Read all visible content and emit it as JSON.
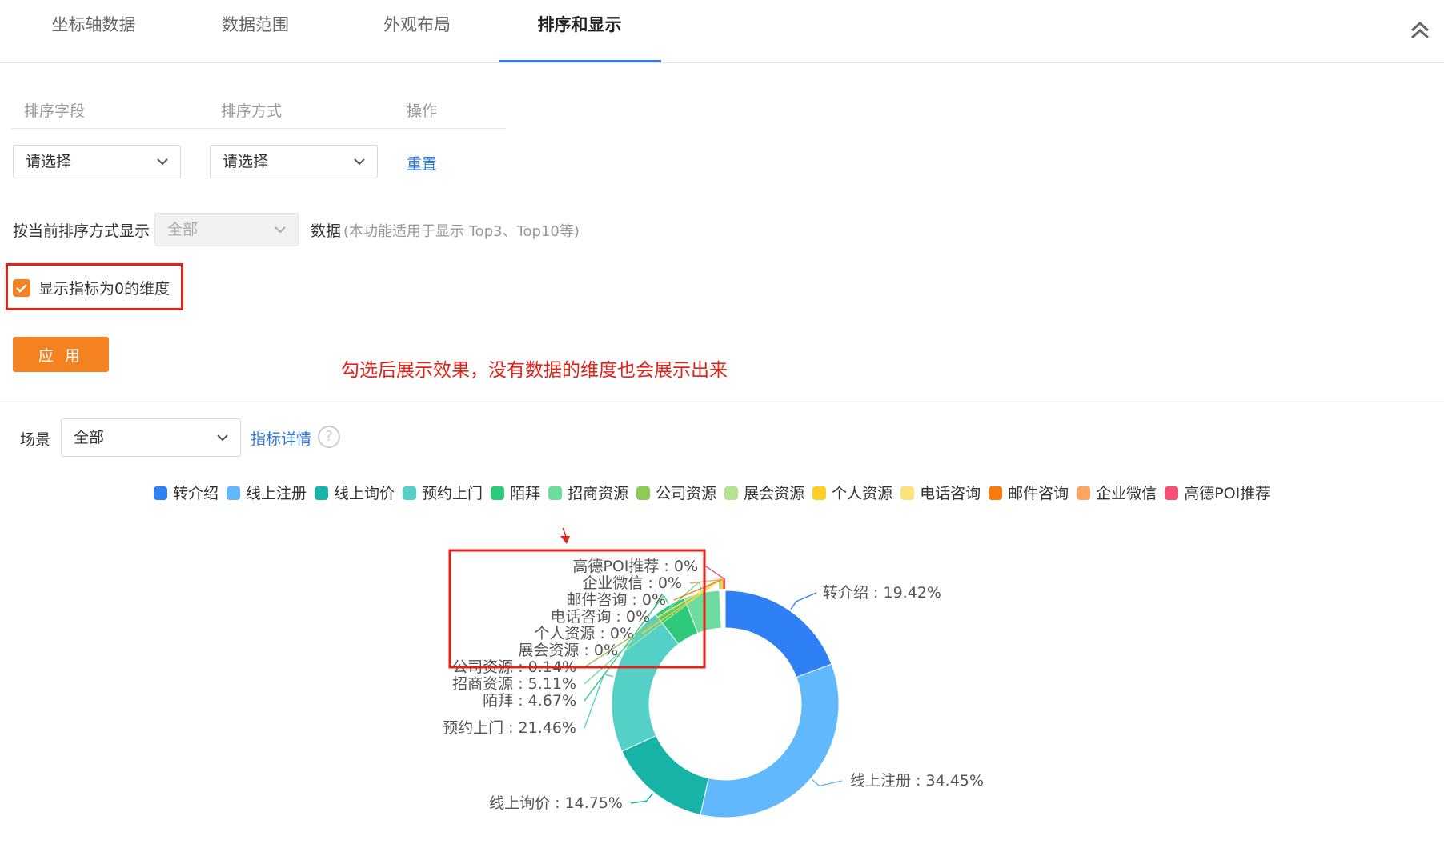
{
  "tabs": [
    {
      "label": "坐标轴数据"
    },
    {
      "label": "数据范围"
    },
    {
      "label": "外观布局"
    },
    {
      "label": "排序和显示"
    }
  ],
  "sort": {
    "headers": {
      "field": "排序字段",
      "method": "排序方式",
      "action": "操作"
    },
    "field_select": "请选择",
    "method_select": "请选择",
    "reset_link": "重置"
  },
  "display": {
    "prefix_label": "按当前排序方式显示",
    "count_select": "全部",
    "suffix_label": "数据",
    "hint": "(本功能适用于显示 Top3、Top10等)"
  },
  "zero_dim": {
    "label": "显示指标为0的维度",
    "checked": true
  },
  "apply_button": "应 用",
  "annotation": "勾选后展示效果，没有数据的维度也会展示出来",
  "scene": {
    "label": "场景",
    "select": "全部",
    "detail_link": "指标详情",
    "help": "?"
  },
  "colors": {
    "accent": "#2f7ae5",
    "orange": "#f58220",
    "highlight": "#e2231a"
  },
  "chart_data": {
    "type": "pie",
    "donut": true,
    "legend_position": "top",
    "series": [
      {
        "name": "转介绍",
        "value": 19.42,
        "label": "转介绍 : 19.42%",
        "color": "#2f7ff5"
      },
      {
        "name": "线上注册",
        "value": 34.45,
        "label": "线上注册 : 34.45%",
        "color": "#62b8fd"
      },
      {
        "name": "线上询价",
        "value": 14.75,
        "label": "线上询价 : 14.75%",
        "color": "#17b3a6"
      },
      {
        "name": "预约上门",
        "value": 21.46,
        "label": "预约上门 : 21.46%",
        "color": "#55d0c6"
      },
      {
        "name": "陌拜",
        "value": 4.67,
        "label": "陌拜 : 4.67%",
        "color": "#2ec97a"
      },
      {
        "name": "招商资源",
        "value": 5.11,
        "label": "招商资源 : 5.11%",
        "color": "#6bdd9c"
      },
      {
        "name": "公司资源",
        "value": 0.14,
        "label": "公司资源 : 0.14%",
        "color": "#8fc95a"
      },
      {
        "name": "展会资源",
        "value": 0,
        "label": "展会资源 : 0%",
        "color": "#b7e193"
      },
      {
        "name": "个人资源",
        "value": 0,
        "label": "个人资源 : 0%",
        "color": "#fdd027"
      },
      {
        "name": "电话咨询",
        "value": 0,
        "label": "电话咨询 : 0%",
        "color": "#fbe37a"
      },
      {
        "name": "邮件咨询",
        "value": 0,
        "label": "邮件咨询 : 0%",
        "color": "#f77a0f"
      },
      {
        "name": "企业微信",
        "value": 0,
        "label": "企业微信 : 0%",
        "color": "#fba761"
      },
      {
        "name": "高德POI推荐",
        "value": 0,
        "label": "高德POI推荐 : 0%",
        "color": "#f45175"
      }
    ]
  }
}
